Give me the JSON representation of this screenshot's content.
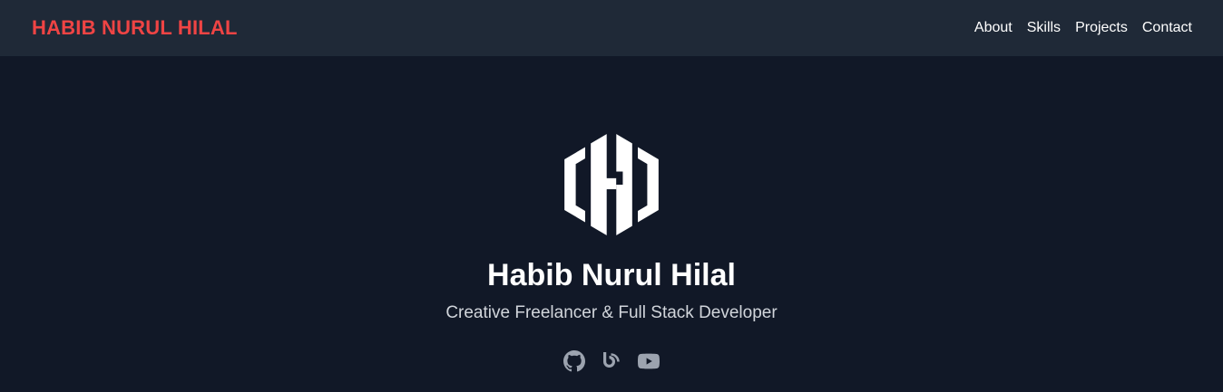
{
  "navbar": {
    "brand": "HABIB NURUL HILAL",
    "links": [
      {
        "label": "About"
      },
      {
        "label": "Skills"
      },
      {
        "label": "Projects"
      },
      {
        "label": "Contact"
      }
    ]
  },
  "hero": {
    "logo_icon": "hexagon-h-logo-icon",
    "title": "Habib Nurul Hilal",
    "subtitle": "Creative Freelancer & Full Stack Developer",
    "social": [
      {
        "icon": "github-icon"
      },
      {
        "icon": "blog-icon"
      },
      {
        "icon": "youtube-icon"
      }
    ]
  },
  "colors": {
    "page_bg": "#111827",
    "navbar_bg": "#1f2937",
    "brand": "#ef4444",
    "title": "#ffffff",
    "subtitle": "#d1d5db",
    "icon": "#9ca3af"
  }
}
